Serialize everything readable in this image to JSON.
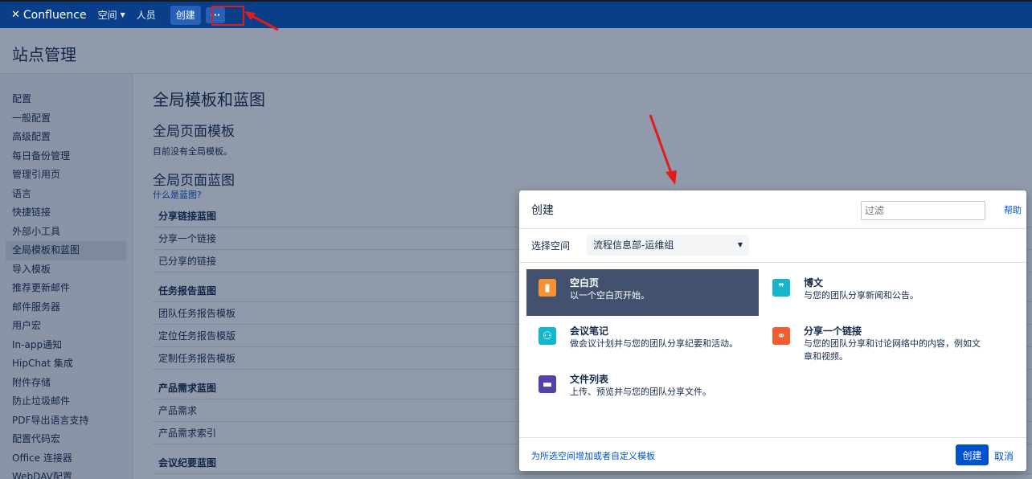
{
  "topbar": {
    "logo_text": "Confluence",
    "nav_spaces": "空间",
    "nav_people": "人员",
    "create_label": "创建",
    "more_label": "···"
  },
  "page": {
    "title": "站点管理"
  },
  "sidebar": {
    "items": [
      "配置",
      "一般配置",
      "高级配置",
      "每日备份管理",
      "管理引用页",
      "语言",
      "快捷链接",
      "外部小工具",
      "全局模板和蓝图",
      "导入模板",
      "推荐更新邮件",
      "邮件服务器",
      "用户宏",
      "In-app通知",
      "HipChat 集成",
      "附件存储",
      "防止垃圾邮件",
      "PDF导出语言支持",
      "配置代码宏",
      "Office 连接器",
      "WebDAV配置"
    ]
  },
  "main": {
    "title": "全局模板和蓝图",
    "templates_heading": "全局页面模板",
    "templates_empty": "目前没有全局模板。",
    "blueprints_heading": "全局页面蓝图",
    "what_is_blueprint": "什么是蓝图?",
    "groups": [
      {
        "name": "分享链接蓝图",
        "items": [
          "分享一个链接",
          "已分享的链接"
        ]
      },
      {
        "name": "任务报告蓝图",
        "items": [
          "团队任务报告模板",
          "定位任务报告模版",
          "定制任务报告模板"
        ]
      },
      {
        "name": "产品需求蓝图",
        "items": [
          "产品需求",
          "产品需求索引"
        ]
      },
      {
        "name": "会议纪要蓝图",
        "items": []
      }
    ]
  },
  "dialog": {
    "title": "创建",
    "filter_placeholder": "过滤",
    "help": "帮助",
    "space_label": "选择空间",
    "space_value": "流程信息部-运维组",
    "templates": [
      {
        "title": "空白页",
        "desc": "以一个空白页开始。",
        "icon": "blank-page-icon",
        "color": "#f79232",
        "glyph": "▮"
      },
      {
        "title": "博文",
        "desc": "与您的团队分享新闻和公告。",
        "icon": "quote-icon",
        "color": "#14b6cc",
        "glyph": "❞"
      },
      {
        "title": "会议笔记",
        "desc": "做会议计划并与您的团队分享纪要和活动。",
        "icon": "people-icon",
        "color": "#14b6cc",
        "glyph": "⚇"
      },
      {
        "title": "分享一个链接",
        "desc": "与您的团队分享和讨论网络中的内容，例如文章和视频。",
        "icon": "link-icon",
        "color": "#f15c30",
        "glyph": "⚭"
      },
      {
        "title": "文件列表",
        "desc": "上传、预览并与您的团队分享文件。",
        "icon": "folder-icon",
        "color": "#5243aa",
        "glyph": "▬"
      }
    ],
    "footer_link": "为所选空间增加或者自定义模板",
    "create_button": "创建",
    "cancel": "取消"
  }
}
